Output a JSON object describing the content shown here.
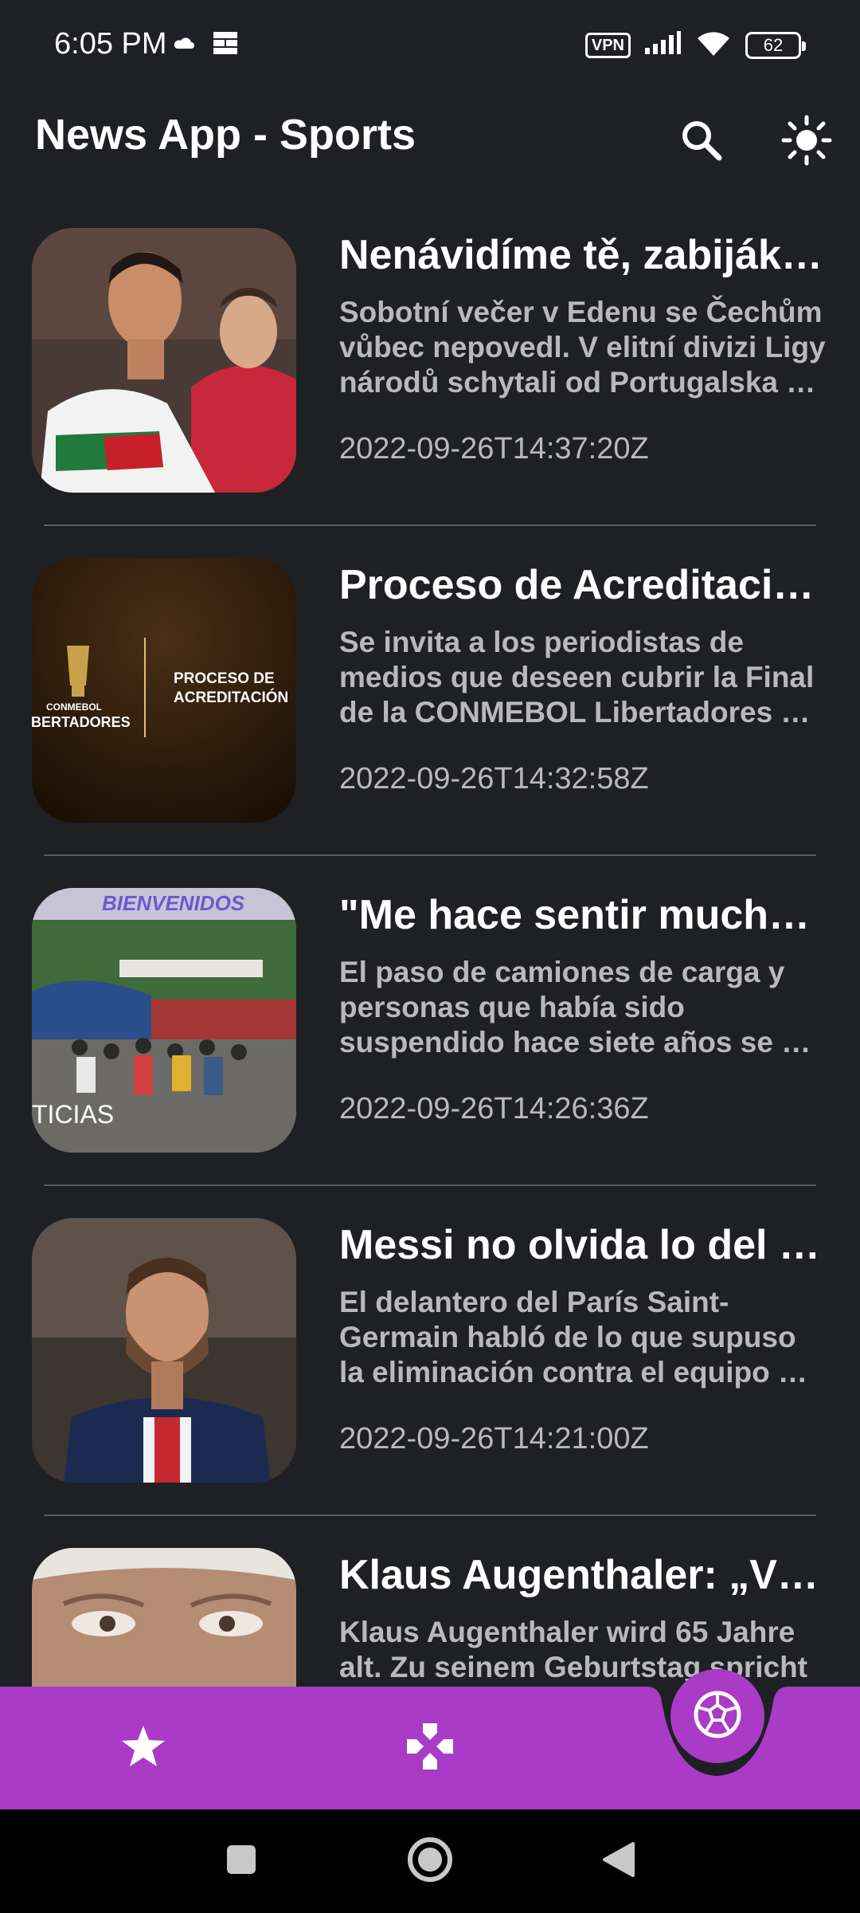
{
  "status_bar": {
    "time": "6:05 PM",
    "vpn": "VPN",
    "battery": "62",
    "icons": [
      "cloud-icon",
      "grid-icon",
      "signal-icon",
      "wifi-icon",
      "battery-icon"
    ]
  },
  "app_bar": {
    "title": "News App - Sports",
    "actions": [
      "search-icon",
      "sun-icon"
    ]
  },
  "articles": [
    {
      "title": "Nenávidíme tě, zabiják…",
      "description": "Sobotní večer v Edenu se Čechům vůbec nepovedl. V elitní divizi Ligy národů schytali od Portugalska …",
      "date": "2022-09-26T14:37:20Z",
      "thumb_label": ""
    },
    {
      "title": "Proceso de Acreditaci…",
      "description": "Se invita a los periodistas de medios que deseen cubrir la Final de la CONMEBOL Libertadores …",
      "date": "2022-09-26T14:32:58Z",
      "thumb_brand_small": "CONMEBOL",
      "thumb_brand": "IBERTADORES",
      "thumb_label": "PROCESO DE ACREDITACIÓN"
    },
    {
      "title": "\"Me hace sentir mucha…",
      "description": "El paso de camiones de carga y personas que había sido suspendido hace siete años se …",
      "date": "2022-09-26T14:26:36Z",
      "thumb_banner": "BIENVENIDOS",
      "thumb_label": "TICIAS"
    },
    {
      "title": "Messi no olvida lo del …",
      "description": "El delantero del París Saint-Germain habló de lo que supuso la eliminación contra el equipo …",
      "date": "2022-09-26T14:21:00Z",
      "thumb_label": ""
    },
    {
      "title": "Klaus Augenthaler: „V…",
      "description": "Klaus Augenthaler wird 65 Jahre alt. Zu seinem Geburtstag spricht",
      "date": "",
      "thumb_label": ""
    }
  ],
  "bottom_nav": {
    "items": [
      "star-icon",
      "gamepad-icon",
      "soccer-ball-icon"
    ],
    "selected": "soccer-ball-icon",
    "color": "#a93bc6"
  },
  "system_nav": [
    "recents-icon",
    "home-icon",
    "back-icon"
  ],
  "colors": {
    "background": "#1f2024",
    "accent": "#a93bc6",
    "secondary_text": "#b8b8bd"
  }
}
